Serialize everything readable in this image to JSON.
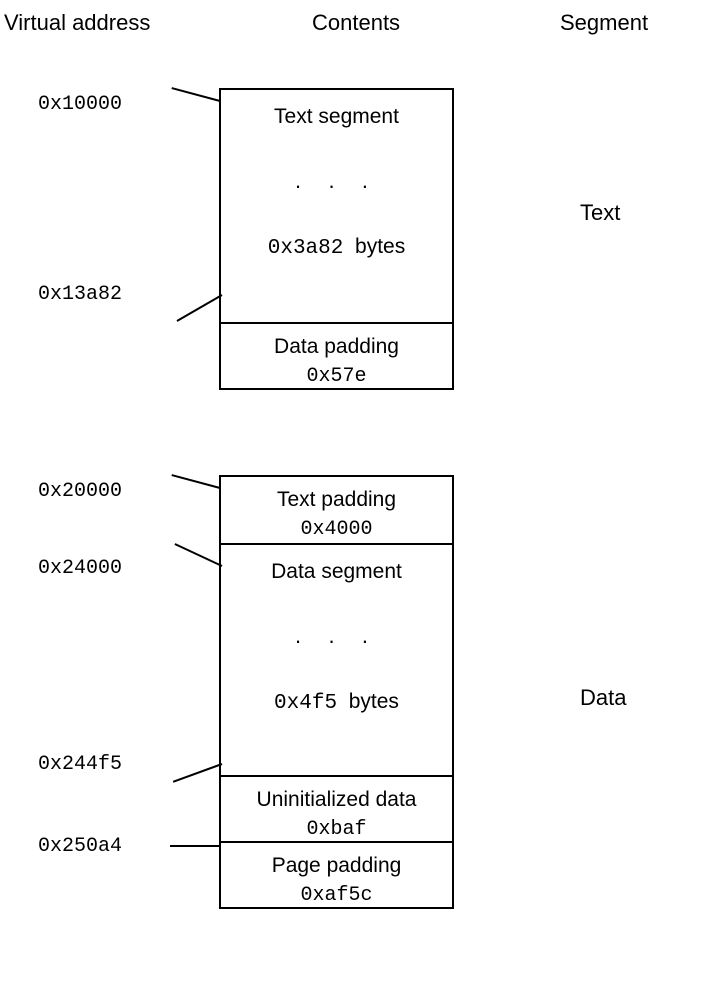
{
  "headers": {
    "virtual_address": "Virtual address",
    "contents": "Contents",
    "segment": "Segment"
  },
  "addresses": {
    "text_start": "0x10000",
    "text_end": "0x13a82",
    "data_textpad_start": "0x20000",
    "data_segment_start": "0x24000",
    "data_end": "0x244f5",
    "uninit_end": "0x250a4"
  },
  "sections": {
    "text_segment": {
      "title": "Text segment",
      "size_hex": "0x3a82",
      "size_unit": "bytes"
    },
    "data_padding": {
      "title": "Data padding",
      "size_hex": "0x57e"
    },
    "text_padding": {
      "title": "Text padding",
      "size_hex": "0x4000"
    },
    "data_segment": {
      "title": "Data segment",
      "size_hex": "0x4f5",
      "size_unit": "bytes"
    },
    "uninitialized": {
      "title": "Uninitialized data",
      "size_hex": "0xbaf"
    },
    "page_padding": {
      "title": "Page padding",
      "size_hex": "0xaf5c"
    }
  },
  "segments": {
    "text": "Text",
    "data": "Data"
  },
  "ellipsis": "· · ·"
}
